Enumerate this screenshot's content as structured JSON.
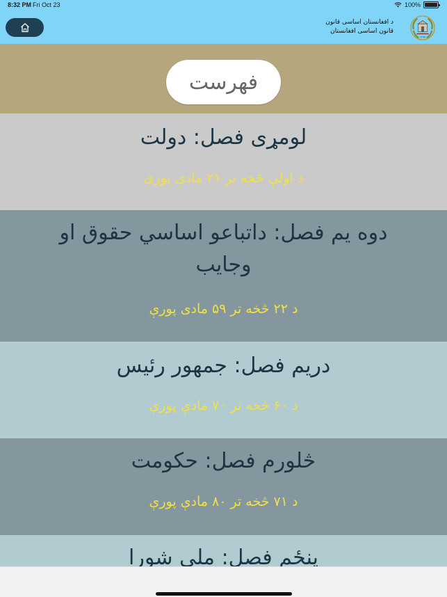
{
  "status": {
    "time": "8:32 PM",
    "date": "Fri Oct 23",
    "battery": "100%"
  },
  "header": {
    "title_line1": "د افغانستان اساسی قانون",
    "title_line2": "قانون اساسی افغانستان"
  },
  "menu": {
    "title": "فهرست"
  },
  "chapters": [
    {
      "title": "لومړی فصل:  دولت",
      "range": "د اولې څخه تر ۲۱ مادې پورې",
      "bg": "#cacaca"
    },
    {
      "title_line1": "دوه یم فصل:  داتباعو اساسي حقوق او",
      "title_line2": "وجایب",
      "range": "د ۲۲ څخه تر ۵۹ مادی پورې",
      "bg": "#85979e"
    },
    {
      "title": "دریم فصل:  جمهور رئیس",
      "range": "د ۶۰ څخه تر ۷۰ مادې پورې",
      "bg": "#b2cbd1"
    },
    {
      "title": "څلورم فصل:  حکومت",
      "range": "د ۷۱ څخه تر ۸۰ مادې پورې",
      "bg": "#85979e"
    },
    {
      "title": "پنځم فصل:  ملي شورا",
      "bg": "#b2cbd1"
    }
  ],
  "colors": {
    "header_bg": "#7fd4f7",
    "menu_area_bg": "#b5a67e",
    "title_text": "#1c3544",
    "range_text": "#f2e143",
    "home_button_bg": "#1f3f52"
  },
  "icons": {
    "home": "home-icon",
    "emblem": "afghanistan-emblem-icon",
    "wifi": "wifi-icon",
    "battery": "battery-icon"
  }
}
